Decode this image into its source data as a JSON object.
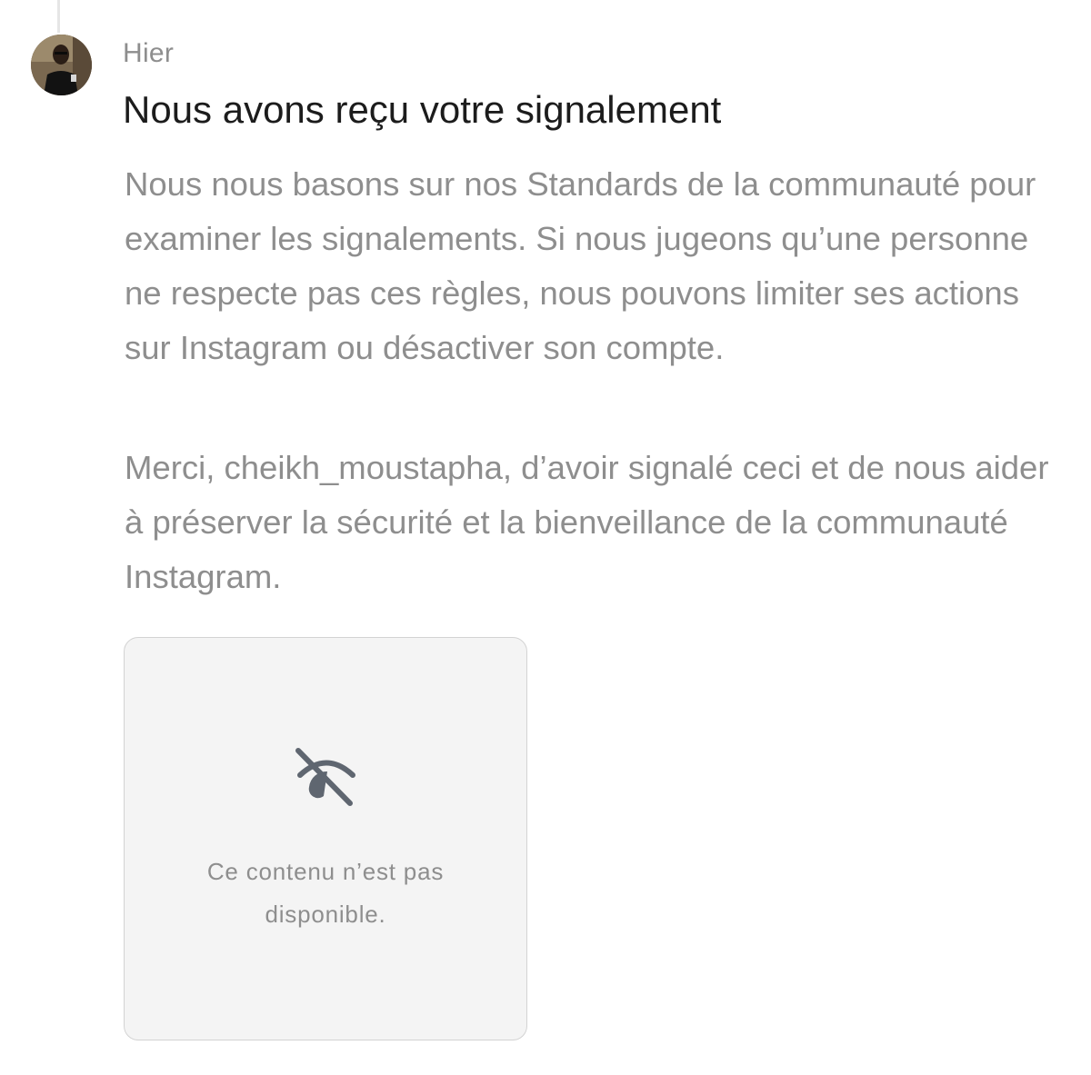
{
  "message": {
    "timestamp": "Hier",
    "title": "Nous avons reçu votre signalement",
    "paragraphs": [
      "Nous nous basons sur nos Standards de la communauté pour examiner les signalements. Si nous jugeons qu’une personne ne respecte pas ces règles, nous pouvons limiter ses actions sur Instagram ou désactiver son compte.",
      "Merci, cheikh_moustapha, d’avoir signalé ceci et de nous aider à préserver la sécurité et la bienveillance de la communauté Instagram."
    ]
  },
  "media": {
    "icon": "eye-slash-icon",
    "unavailable_line_1": "Ce contenu n’est pas",
    "unavailable_line_2": "disponible."
  },
  "colors": {
    "title": "#1c1c1c",
    "secondary_text": "#8e8e8e",
    "card_background": "#f4f4f4",
    "card_border": "#d3d3d3",
    "icon": "#5f6670"
  }
}
